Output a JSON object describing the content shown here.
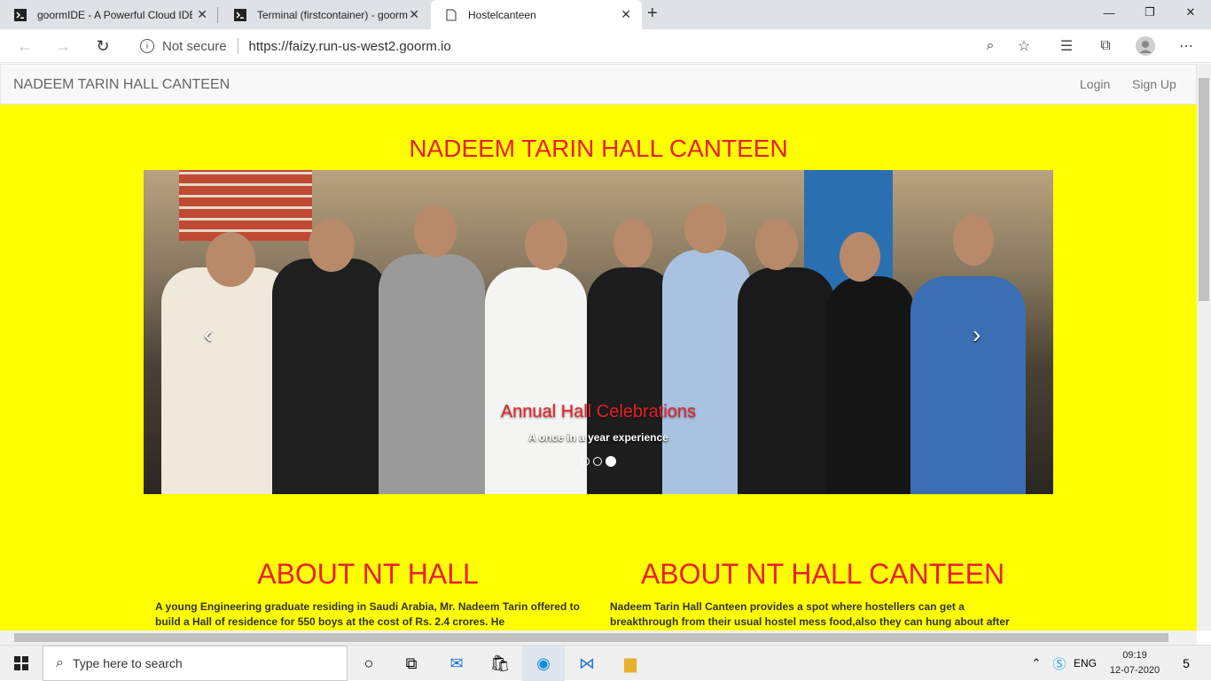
{
  "browser": {
    "tabs": [
      {
        "title": "goormIDE - A Powerful Cloud IDE",
        "icon": "terminal-icon"
      },
      {
        "title": "Terminal (firstcontainer) - goorm",
        "icon": "terminal-icon"
      },
      {
        "title": "Hostelcanteen",
        "icon": "page-icon"
      }
    ],
    "security": "Not secure",
    "url": "https://faizy.run-us-west2.goorm.io"
  },
  "site": {
    "brand": "NADEEM TARIN HALL CANTEEN",
    "nav": {
      "login": "Login",
      "signup": "Sign Up"
    },
    "page_title": "NADEEM TARIN HALL CANTEEN",
    "carousel": {
      "caption_title": "Annual Hall Celebrations",
      "caption_sub": "A once in a year experience",
      "slides": 3,
      "active_slide": 3
    },
    "about_hall": {
      "heading": "ABOUT NT HALL",
      "text": "A young Engineering graduate residing in Saudi Arabia, Mr. Nadeem Tarin offered to build a Hall of residence for 550 boys at the cost of Rs. 2.4 crores. He"
    },
    "about_canteen": {
      "heading": "ABOUT NT HALL CANTEEN",
      "text": "Nadeem Tarin Hall Canteen provides a spot where hostellers can get a breakthrough from their usual hostel mess food,also they can hung about after"
    }
  },
  "taskbar": {
    "search_placeholder": "Type here to search",
    "lang": "ENG",
    "time": "09:19",
    "date": "12-07-2020",
    "notifications": "5"
  }
}
